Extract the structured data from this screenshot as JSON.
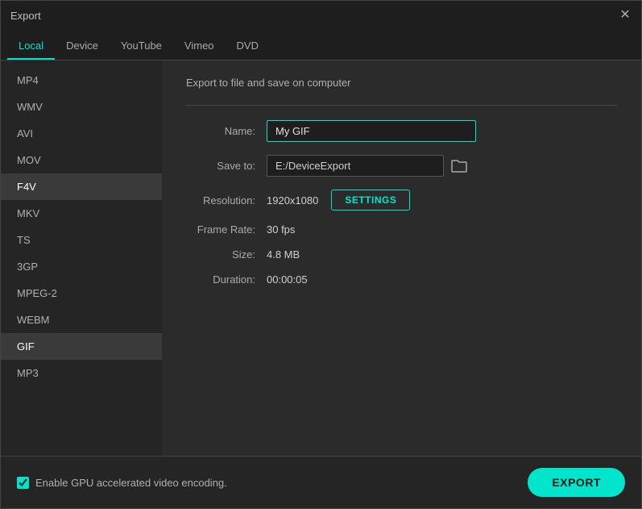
{
  "window": {
    "title": "Export"
  },
  "tabs": [
    {
      "label": "Local",
      "active": true
    },
    {
      "label": "Device",
      "active": false
    },
    {
      "label": "YouTube",
      "active": false
    },
    {
      "label": "Vimeo",
      "active": false
    },
    {
      "label": "DVD",
      "active": false
    }
  ],
  "sidebar": {
    "items": [
      {
        "label": "MP4",
        "active": false
      },
      {
        "label": "WMV",
        "active": false
      },
      {
        "label": "AVI",
        "active": false
      },
      {
        "label": "MOV",
        "active": false
      },
      {
        "label": "F4V",
        "active": false
      },
      {
        "label": "MKV",
        "active": false
      },
      {
        "label": "TS",
        "active": false
      },
      {
        "label": "3GP",
        "active": false
      },
      {
        "label": "MPEG-2",
        "active": false
      },
      {
        "label": "WEBM",
        "active": false
      },
      {
        "label": "GIF",
        "active": true
      },
      {
        "label": "MP3",
        "active": false
      }
    ]
  },
  "content": {
    "section_title": "Export to file and save on computer",
    "name_label": "Name:",
    "name_value": "My GIF",
    "save_to_label": "Save to:",
    "save_to_path": "E:/DeviceExport",
    "resolution_label": "Resolution:",
    "resolution_value": "1920x1080",
    "settings_button": "SETTINGS",
    "frame_rate_label": "Frame Rate:",
    "frame_rate_value": "30 fps",
    "size_label": "Size:",
    "size_value": "4.8 MB",
    "duration_label": "Duration:",
    "duration_value": "00:00:05"
  },
  "footer": {
    "gpu_label": "Enable GPU accelerated video encoding.",
    "export_button": "EXPORT"
  },
  "icons": {
    "close": "✕",
    "folder": "🗁"
  }
}
